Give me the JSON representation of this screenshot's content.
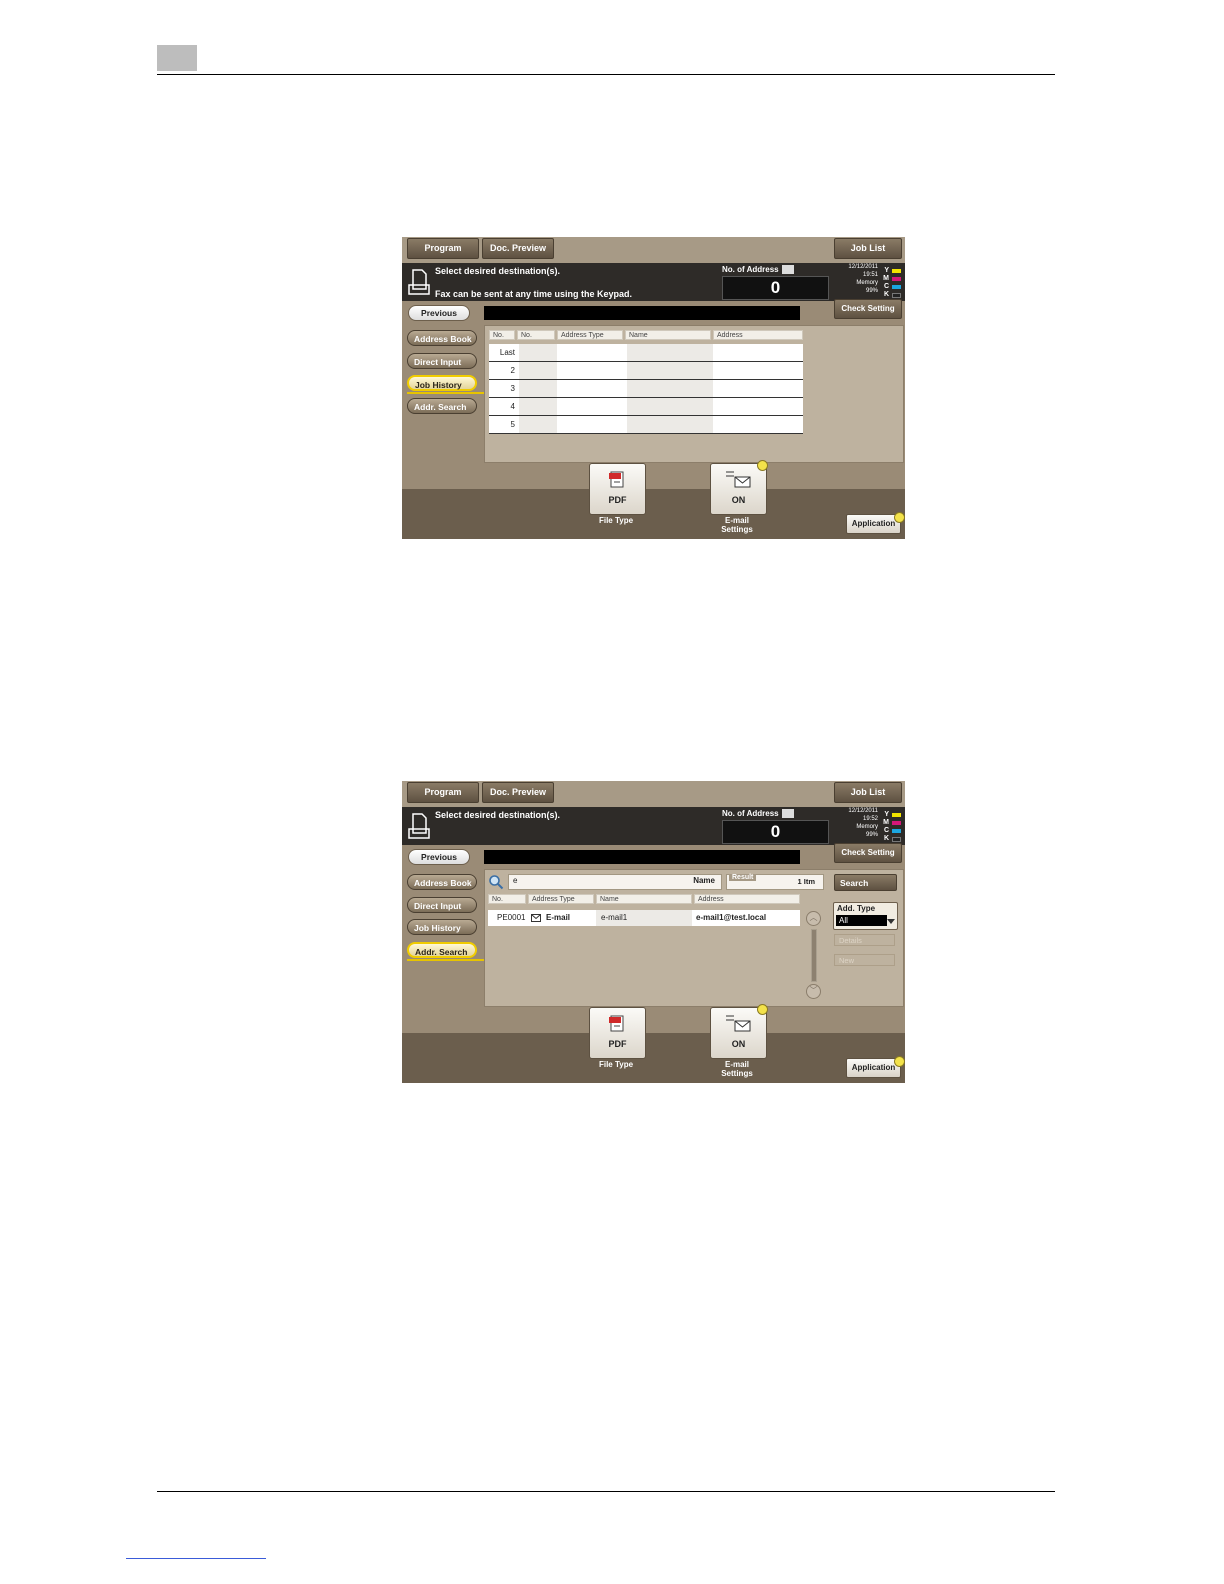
{
  "screens": [
    {
      "topbar": {
        "program": "Program",
        "doc_preview": "Doc. Preview",
        "job_list": "Job List"
      },
      "message": {
        "line1": "Select desired destination(s).",
        "line2": "Fax can be sent at any time using the Keypad."
      },
      "address_count": {
        "label": "No. of Address",
        "value": "0"
      },
      "status": {
        "date": "12/12/2011",
        "time": "19:51",
        "memory_label": "Memory",
        "memory_value": "99%",
        "toner": [
          "Y",
          "M",
          "C",
          "K"
        ]
      },
      "previous": "Previous",
      "check_setting": "Check Setting",
      "sidebar": [
        "Address Book",
        "Direct Input",
        "Job History",
        "Addr. Search"
      ],
      "active_tab": "Job History",
      "table": {
        "headers": [
          "No.",
          "No.",
          "Address Type",
          "Name",
          "Address"
        ],
        "rows": [
          "Last",
          "2",
          "3",
          "4",
          "5"
        ]
      },
      "functions": {
        "file_type_value": "PDF",
        "file_type_label": "File Type",
        "email_value": "ON",
        "email_label_1": "E-mail",
        "email_label_2": "Settings"
      },
      "application": "Application"
    },
    {
      "topbar": {
        "program": "Program",
        "doc_preview": "Doc. Preview",
        "job_list": "Job List"
      },
      "message": {
        "line1": "Select desired destination(s)."
      },
      "address_count": {
        "label": "No. of Address",
        "value": "0"
      },
      "status": {
        "date": "12/12/2011",
        "time": "19:52",
        "memory_label": "Memory",
        "memory_value": "99%",
        "toner": [
          "Y",
          "M",
          "C",
          "K"
        ]
      },
      "previous": "Previous",
      "check_setting": "Check Setting",
      "sidebar": [
        "Address Book",
        "Direct Input",
        "Job History",
        "Addr. Search"
      ],
      "active_tab": "Addr. Search",
      "search": {
        "query": "e",
        "field": "Name",
        "result_label": "Result",
        "result_value": "1 Itm",
        "button": "Search"
      },
      "table": {
        "headers": [
          "No.",
          "Address Type",
          "Name",
          "Address"
        ],
        "rows": [
          {
            "no": "PE0001",
            "type": "E-mail",
            "name": "e-mail1",
            "address": "e-mail1@test.local"
          }
        ]
      },
      "add_type": {
        "label": "Add. Type",
        "value": "All"
      },
      "details": "Details",
      "new": "New",
      "functions": {
        "file_type_value": "PDF",
        "file_type_label": "File Type",
        "email_value": "ON",
        "email_label_1": "E-mail",
        "email_label_2": "Settings"
      },
      "application": "Application"
    }
  ]
}
